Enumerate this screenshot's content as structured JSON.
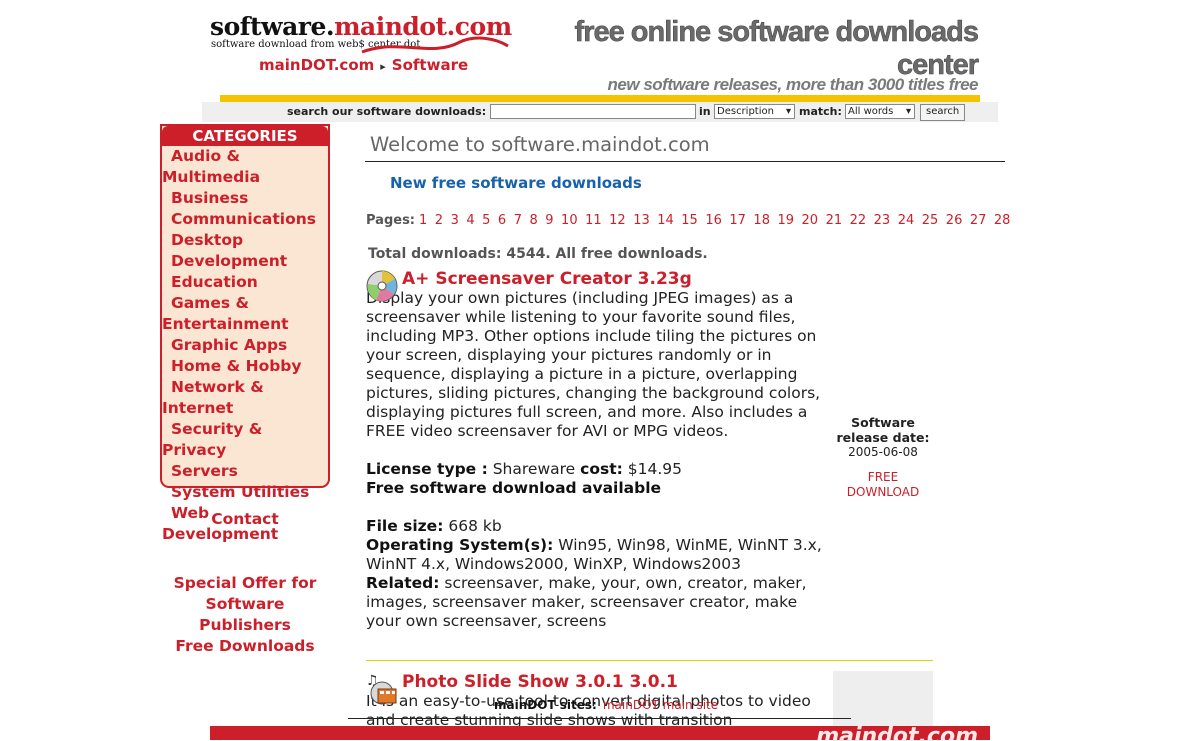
{
  "header": {
    "logo_prefix": "software.",
    "logo_brand": "maindot",
    "logo_suffix": ".com",
    "logo_tagline": "software download from  web$ center dot",
    "breadcrumb_home": "mainDOT.com",
    "breadcrumb_current": "Software",
    "slogan_main": "free online software downloads center",
    "slogan_sub": "new software releases, more than 3000 titles free"
  },
  "search": {
    "label": "search our software downloads:",
    "value": "",
    "in_label": "in",
    "in_selected": "Description",
    "match_label": "match:",
    "match_selected": "All words",
    "button": "search"
  },
  "categories": {
    "heading": "CATEGORIES",
    "items": [
      "Audio &",
      "Multimedia",
      "Business",
      "Communications",
      "Desktop",
      "Development",
      "Education",
      "Games &",
      "Entertainment",
      "Graphic Apps",
      "Home & Hobby",
      "Network & Internet",
      "Security & Privacy",
      "Servers",
      "System Utilities",
      "Web Development"
    ]
  },
  "sidebar_links": {
    "contact": "Contact",
    "offer_line1": "Special Offer for",
    "offer_line2": "Software Publishers",
    "offer_line3": "Free Downloads"
  },
  "main": {
    "welcome": "Welcome to software.maindot.com",
    "new_downloads": "New free software downloads",
    "pages_label": "Pages:",
    "pages": [
      "1",
      "2",
      "3",
      "4",
      "5",
      "6",
      "7",
      "8",
      "9",
      "10",
      "11",
      "12",
      "13",
      "14",
      "15",
      "16",
      "17",
      "18",
      "19",
      "20",
      "21",
      "22",
      "23",
      "24",
      "25",
      "26",
      "27",
      "28"
    ],
    "total": "Total downloads: 4544. All free downloads."
  },
  "entries": [
    {
      "icon": "cd-disc-icon",
      "title": "A+ Screensaver Creator 3.23g",
      "description": "Display your own pictures (including JPEG images) as a screensaver while listening to your favorite sound files, including MP3. Other options include tiling the pictures on your screen, displaying your pictures randomly or in sequence, displaying a picture in a picture, overlapping pictures, sliding pictures, changing the background colors, displaying pictures full screen, and more. Also includes a FREE video screensaver for AVI or MPG videos.",
      "license_label": "License type :",
      "license_value": "Shareware",
      "cost_label": "cost:",
      "cost_value": "$14.95",
      "free_note": "Free software download available",
      "filesize_label": "File size:",
      "filesize_value": "668 kb",
      "os_label": "Operating System(s):",
      "os_value": "Win95, Win98, WinME, WinNT 3.x, WinNT 4.x, Windows2000, WinXP, Windows2003",
      "related_label": "Related:",
      "related_value": "screensaver, make, your, own, creator, maker, images, screensaver maker, screensaver creator, make your own screensaver, screens",
      "release_label1": "Software",
      "release_label2": "release date:",
      "release_date": "2005-06-08",
      "download1": "FREE",
      "download2": "DOWNLOAD"
    },
    {
      "icon": "film-music-icon",
      "title": "Photo Slide Show 3.0.1 3.0.1",
      "description": "It is an easy-to-use tool to convert digital photos to video and create stunning slide shows with transition"
    }
  ],
  "footer": {
    "sites_label": "mainDOT sites:",
    "sites_link": "mainDOT main site",
    "banner_text": "maindot.com"
  },
  "colors": {
    "accent": "#cc1f2a",
    "link_blue": "#1761ad",
    "category_bg": "#fbe6d3",
    "bar_yellow": "#f5c400"
  }
}
